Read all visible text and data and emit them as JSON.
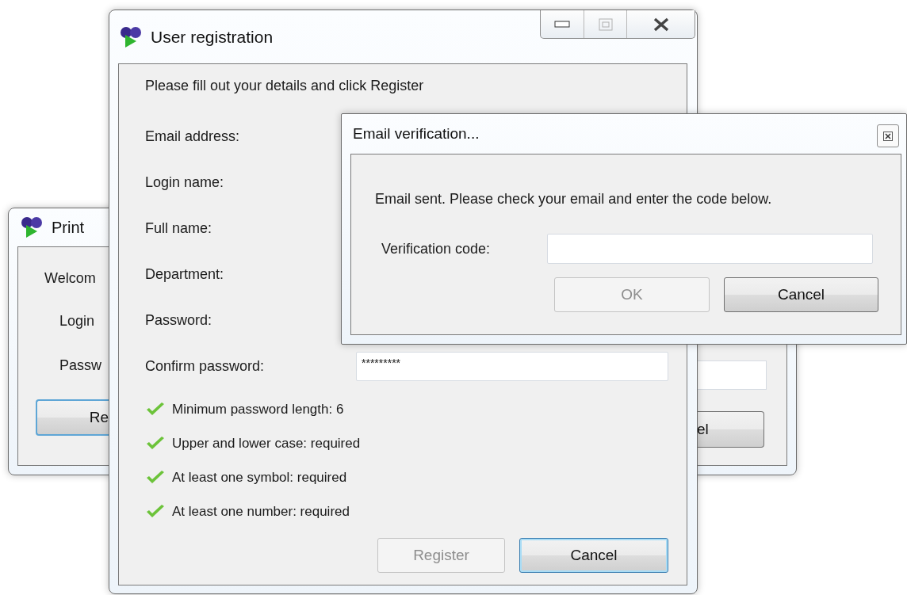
{
  "back_window": {
    "title": "Print",
    "welcome": "Welcom",
    "labels": [
      "Login",
      "Passw"
    ],
    "left_button": "Re",
    "right_button": "el"
  },
  "registration": {
    "title": "User registration",
    "intro": "Please fill out your details and click Register",
    "fields": [
      {
        "label": "Email address:"
      },
      {
        "label": "Login name:"
      },
      {
        "label": "Full name:"
      },
      {
        "label": "Department:"
      },
      {
        "label": "Password:"
      },
      {
        "label": "Confirm password:",
        "value": "*********"
      }
    ],
    "rules": [
      {
        "text": "Minimum password length: 6",
        "met": true
      },
      {
        "text": "Upper and lower case: required",
        "met": true
      },
      {
        "text": "At least one symbol: required",
        "met": true
      },
      {
        "text": "At least one number: required",
        "met": true
      }
    ],
    "buttons": [
      {
        "label": "Register",
        "disabled": true,
        "focused": false
      },
      {
        "label": "Cancel",
        "disabled": false,
        "focused": true
      }
    ]
  },
  "dialog": {
    "title": "Email verification...",
    "message": "Email sent. Please check your email and enter the code below.",
    "field_label": "Verification code:",
    "buttons": [
      {
        "label": "OK",
        "disabled": true
      },
      {
        "label": "Cancel",
        "disabled": false
      }
    ]
  }
}
